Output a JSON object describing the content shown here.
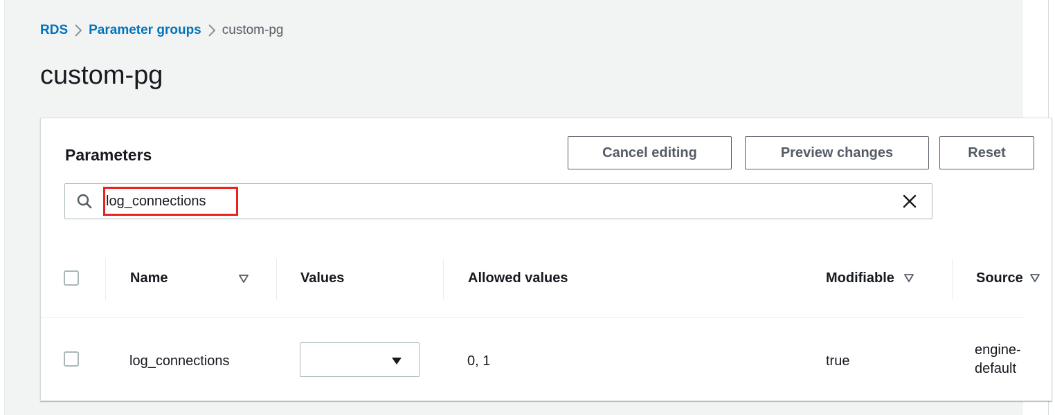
{
  "breadcrumb": {
    "items": [
      "RDS",
      "Parameter groups"
    ],
    "current": "custom-pg"
  },
  "page": {
    "title": "custom-pg"
  },
  "parameters_panel": {
    "title": "Parameters",
    "buttons": {
      "cancel": "Cancel editing",
      "preview": "Preview changes",
      "reset": "Reset"
    },
    "search": {
      "value": "log_connections",
      "placeholder": ""
    },
    "table": {
      "columns": [
        "Name",
        "Values",
        "Allowed values",
        "Modifiable",
        "Source"
      ],
      "rows": [
        {
          "name": "log_connections",
          "value": "",
          "allowed_values": "0, 1",
          "modifiable": "true",
          "source_line1": "engine-",
          "source_line2": "default"
        }
      ]
    }
  },
  "colors": {
    "link": "#0073bb",
    "highlight": "#e8231b",
    "text": "#16191f",
    "muted": "#545b64",
    "background": "#f2f3f3"
  },
  "icons": [
    "chevron-right-icon",
    "search-icon",
    "close-icon",
    "sort-down-icon",
    "caret-down-icon"
  ]
}
